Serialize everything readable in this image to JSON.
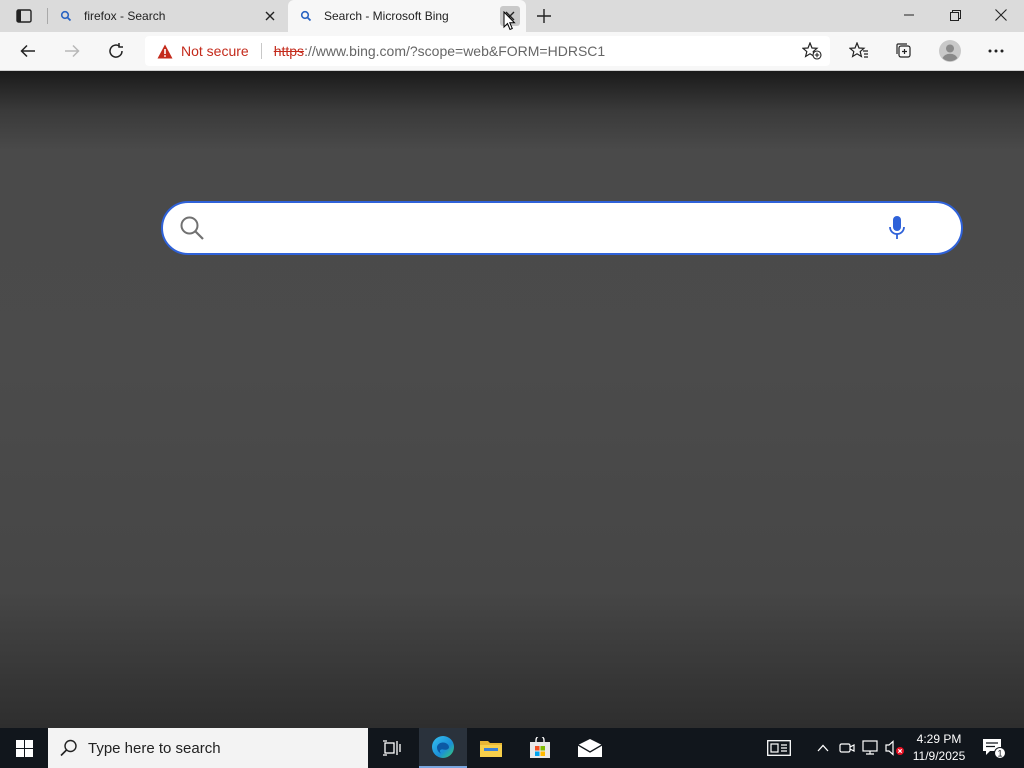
{
  "tabs": [
    {
      "title": "firefox - Search",
      "active": false
    },
    {
      "title": "Search - Microsoft Bing",
      "active": true
    }
  ],
  "address_bar": {
    "security_label": "Not secure",
    "url_scheme": "https",
    "url_rest": "://www.bing.com/?scope=web&FORM=HDRSC1",
    "url_host": "www.bing.com",
    "url_path": "/?scope=web&FORM=HDRSC1"
  },
  "search": {
    "value": "",
    "placeholder": ""
  },
  "taskbar": {
    "search_placeholder": "Type here to search",
    "time": "4:29 PM",
    "date": "11/9/2025",
    "notification_count": "1"
  },
  "colors": {
    "accent_blue": "#2f62d9",
    "not_secure_red": "#c42b1c",
    "taskbar_bg": "#11161c"
  },
  "icons": [
    "tab-actions-icon",
    "bing-search-icon",
    "close-icon",
    "plus-icon",
    "minimize-icon",
    "restore-icon",
    "back-icon",
    "forward-icon",
    "refresh-icon",
    "warning-icon",
    "add-favorite-icon",
    "favorites-icon",
    "collections-icon",
    "profile-icon",
    "more-icon",
    "search-icon",
    "microphone-icon",
    "windows-logo-icon",
    "task-view-icon",
    "edge-icon",
    "file-explorer-icon",
    "store-icon",
    "mail-icon",
    "news-icon",
    "chevron-up-icon",
    "meet-now-icon",
    "network-icon",
    "volume-muted-icon",
    "notification-icon"
  ]
}
